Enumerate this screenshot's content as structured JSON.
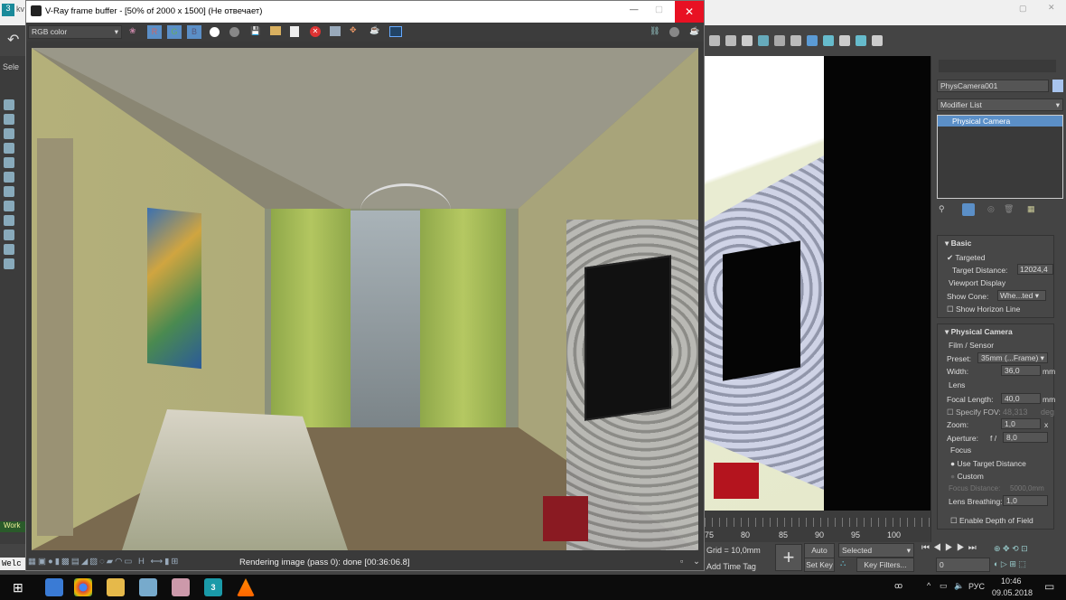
{
  "max": {
    "title_fragment": "kv",
    "left_label": "Sele",
    "left_status": "Work",
    "welcome": "Welc"
  },
  "vfb": {
    "title": "V-Ray frame buffer - [50% of 2000 x 1500] (Не отвечает)",
    "channel": "RGB color",
    "r": "R",
    "g": "G",
    "b": "B",
    "status": "Rendering image (pass 0): done [00:36:06.8]",
    "h": "H"
  },
  "command_panel": {
    "object_name": "PhysCamera001",
    "modifier_list": "Modifier List",
    "stack_item": "Physical Camera",
    "basic": {
      "title": "Basic",
      "targeted": "Targeted",
      "target_distance_label": "Target Distance:",
      "target_distance": "12024,4",
      "viewport_display": "Viewport Display",
      "show_cone_label": "Show Cone:",
      "show_cone": "Whe...ted",
      "show_horizon": "Show Horizon Line"
    },
    "physical": {
      "title": "Physical Camera",
      "film": "Film / Sensor",
      "preset_label": "Preset:",
      "preset": "35mm (...Frame)",
      "width_label": "Width:",
      "width": "36,0",
      "mm": "mm",
      "lens": "Lens",
      "focal_label": "Focal Length:",
      "focal": "40,0",
      "fov_label": "Specify FOV:",
      "fov": "48,313",
      "deg": "deg",
      "zoom_label": "Zoom:",
      "zoom": "1,0",
      "x": "x",
      "aperture_label": "Aperture:",
      "f": "f /",
      "aperture": "8,0",
      "focus": "Focus",
      "use_target": "Use Target Distance",
      "custom": "Custom",
      "focus_distance_label": "Focus Distance:",
      "focus_distance": "5000,0mm",
      "breathing_label": "Lens Breathing:",
      "breathing": "1,0",
      "dof": "Enable Depth of Field"
    }
  },
  "timeline": {
    "ticks": [
      "75",
      "80",
      "85",
      "90",
      "95",
      "100"
    ]
  },
  "bottom": {
    "grid": "Grid = 10,0mm",
    "add_time_tag": "Add Time Tag",
    "auto_key": "Auto Key",
    "set_key": "Set Key",
    "selected": "Selected",
    "key_filters": "Key Filters...",
    "frame": "0"
  },
  "taskbar": {
    "lang": "РУС",
    "time": "10:46",
    "date": "09.05.2018"
  }
}
